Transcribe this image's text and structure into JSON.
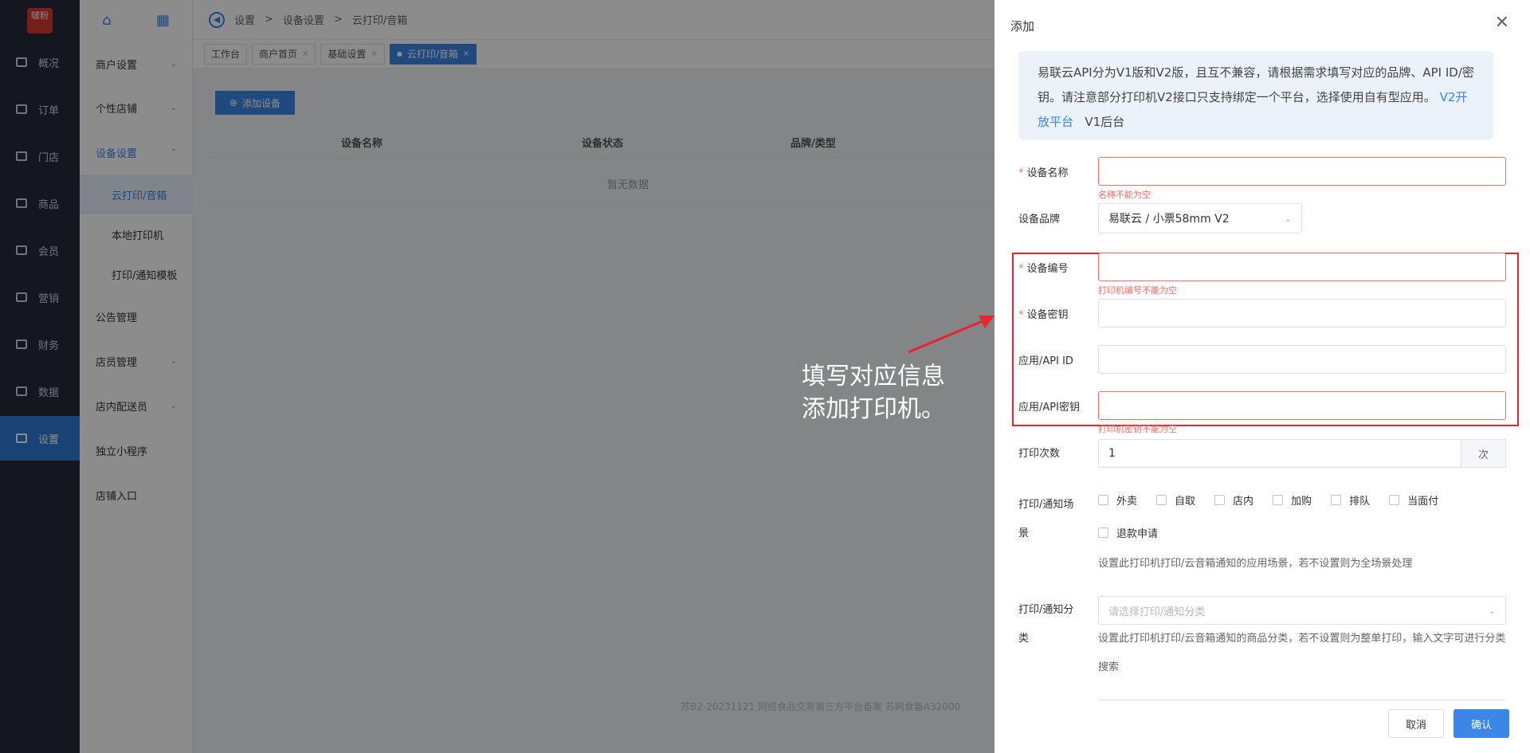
{
  "rail": {
    "logo": "啵粉",
    "items": [
      {
        "label": "概况",
        "icon": "overview-icon"
      },
      {
        "label": "订单",
        "icon": "order-icon"
      },
      {
        "label": "门店",
        "icon": "store-icon"
      },
      {
        "label": "商品",
        "icon": "goods-icon"
      },
      {
        "label": "会员",
        "icon": "member-icon"
      },
      {
        "label": "营销",
        "icon": "marketing-icon"
      },
      {
        "label": "财务",
        "icon": "finance-icon"
      },
      {
        "label": "数据",
        "icon": "data-icon"
      },
      {
        "label": "设置",
        "icon": "settings-icon"
      }
    ],
    "active_index": 8
  },
  "sub": {
    "items": [
      {
        "label": "商户设置",
        "chev": "⌄"
      },
      {
        "label": "个性店铺",
        "chev": "⌄"
      },
      {
        "label": "设备设置",
        "chev": "⌃"
      },
      {
        "label": "云打印/音箱"
      },
      {
        "label": "本地打印机"
      },
      {
        "label": "打印/通知模板"
      },
      {
        "label": "公告管理"
      },
      {
        "label": "店员管理",
        "chev": "⌄"
      },
      {
        "label": "店内配送员",
        "chev": "⌄"
      },
      {
        "label": "独立小程序"
      },
      {
        "label": "店铺入口"
      }
    ]
  },
  "breadcrumb": [
    "设置",
    "设备设置",
    "云打印/音箱"
  ],
  "tabs": [
    {
      "label": "工作台",
      "closable": false
    },
    {
      "label": "商户首页",
      "closable": true
    },
    {
      "label": "基础设置",
      "closable": true
    },
    {
      "label": "云打印/音箱",
      "closable": true
    }
  ],
  "add_button": "添加设备",
  "table": {
    "headers": [
      "设备名称",
      "设备状态",
      "品牌/类型"
    ],
    "empty": "暂无数据"
  },
  "footer": "苏B2-20231121  网络食品交易第三方平台备案 苏网食备A32000",
  "annotation": {
    "line1": "填写对应信息",
    "line2": "添加打印机。"
  },
  "drawer": {
    "title": "添加",
    "notice_text": "易联云API分为V1版和V2版，且互不兼容，请根据需求填写对应的品牌、API ID/密钥。请注意部分打印机V2接口只支持绑定一个平台，选择使用自有型应用。",
    "notice_link1": "V2开放平台",
    "notice_link2": "V1后台",
    "fields": {
      "device_name": {
        "label": "设备名称",
        "error": "名称不能为空",
        "value": ""
      },
      "brand": {
        "label": "设备品牌",
        "value": "易联云 / 小票58mm V2"
      },
      "device_no": {
        "label": "设备编号",
        "error": "打印机编号不能为空",
        "value": ""
      },
      "device_key": {
        "label": "设备密钥",
        "value": ""
      },
      "api_id": {
        "label": "应用/API ID",
        "value": ""
      },
      "api_key": {
        "label": "应用/API密钥",
        "error": "打印机密钥不能为空",
        "value": ""
      },
      "print_times": {
        "label": "打印次数",
        "value": "1",
        "unit": "次"
      }
    },
    "scene": {
      "label_line1": "打印/通知场",
      "label_line2": "景",
      "options_row1": [
        "外卖",
        "自取",
        "店内",
        "加购",
        "排队",
        "当面付"
      ],
      "options_row2": [
        "退款申请"
      ],
      "hint": "设置此打印机打印/云音箱通知的应用场景，若不设置则为全场景处理"
    },
    "category": {
      "label_line1": "打印/通知分",
      "label_line2": "类",
      "placeholder": "请选择打印/通知分类",
      "hint": "设置此打印机打印/云音箱通知的商品分类，若不设置则为整单打印，输入文字可进行分类搜索"
    },
    "cancel": "取消",
    "confirm": "确认"
  }
}
